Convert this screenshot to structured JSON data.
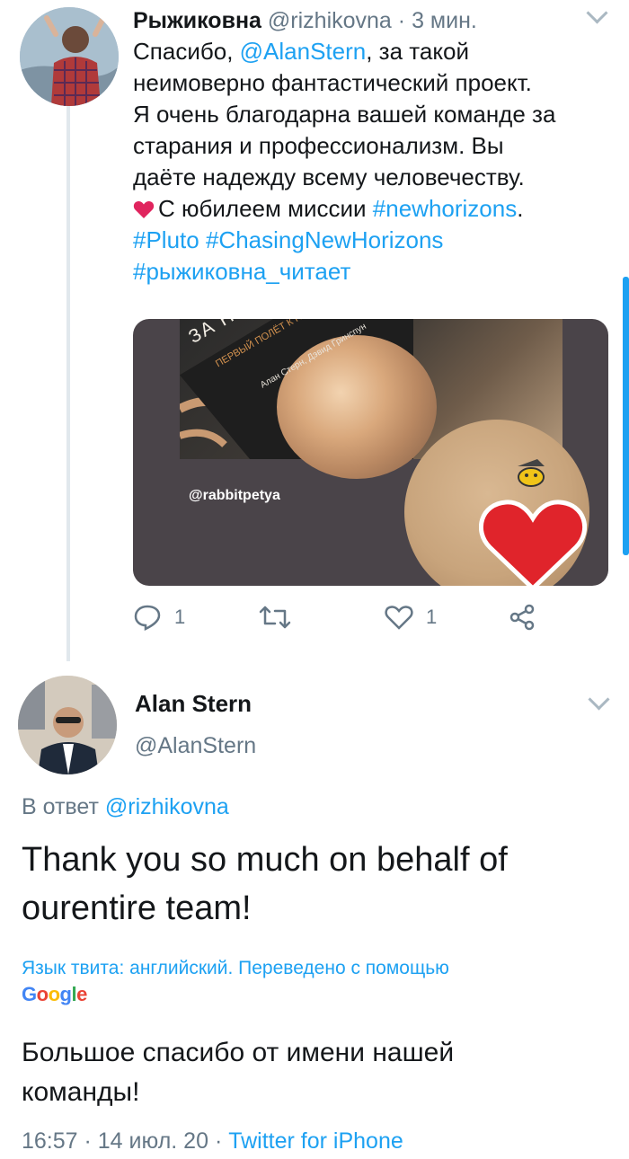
{
  "tweet1": {
    "name": "Рыжиковна",
    "handle": "@rizhikovna",
    "time_sep": " · ",
    "time": "3 мин.",
    "lines": [
      [
        "Спасибо, ",
        "@AlanStern",
        ", за такой"
      ],
      "неимоверно фантастический проект.",
      "Я очень благодарна вашей команде за",
      "старания и профессионализм. Вы",
      "даёте надежду всему человечеству."
    ],
    "line6_text": "С юбилеем миссии ",
    "line6_hashtag": "#newhorizons",
    "line6_end": ".",
    "line7_hashtag1": "#Pluto",
    "line7_hashtag2": "#ChasingNewHorizons",
    "line8_hashtag": "#рыжиковна_читает",
    "mention_1": "@AlanStern",
    "line1_start": "Спасибо, ",
    "line1_end": ", за такой",
    "line2": "неимоверно фантастический проект.",
    "line3": "Я очень благодарна вашей команде за",
    "line4": "старания и профессионализм. Вы",
    "line5": "даёте надежду всему человечеству.",
    "media": {
      "book_title": "ЗА  НОВЫМИ  ГОРИЗОНТАМИ",
      "book_subtitle": "ПЕРВЫЙ ПОЛЁТ К ПЛУТОНУ",
      "book_authors": "Алан Стерн, Дэвид Гринспун",
      "mention_badge": "@rabbitpetya"
    },
    "actions": {
      "reply_count": "1",
      "like_count": "1"
    }
  },
  "tweet2": {
    "name": "Alan Stern",
    "handle": "@AlanStern",
    "reply_prefix": "В ответ ",
    "reply_handle": "@rizhikovna",
    "body_line1": "Thank you so much on behalf of",
    "body_line2": "ourentire team!",
    "translation_note": "Язык твита: английский. Переведено с помощью",
    "translator": "Google",
    "translated_line1": "Большое спасибо от имени нашей",
    "translated_line2": "команды!",
    "time": "16:57",
    "sep": " · ",
    "date": "14 июл. 20",
    "source": "Twitter for iPhone"
  },
  "colors": {
    "link": "#1da1f2",
    "secondary_text": "#657786",
    "primary_text": "#14171a",
    "heart": "#e0245e"
  }
}
